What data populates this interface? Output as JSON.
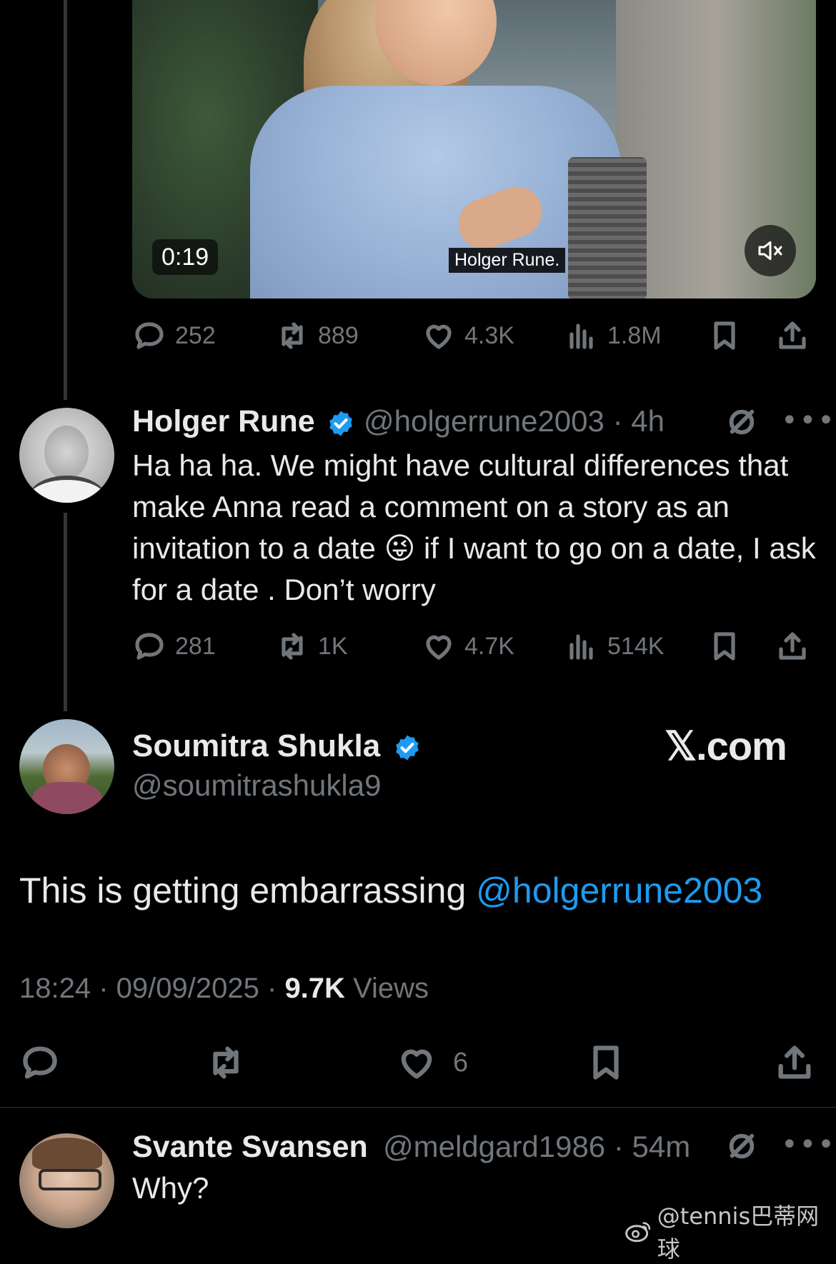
{
  "video": {
    "timecode": "0:19",
    "caption": "Holger Rune.",
    "mute_icon": "speaker-muted-icon"
  },
  "tweet1_actions": {
    "replies": "252",
    "reposts": "889",
    "likes": "4.3K",
    "views": "1.8M"
  },
  "holger_tweet": {
    "name": "Holger Rune",
    "handle": "@holgerrune2003",
    "time": "· 4h",
    "text_before_emoji": "Ha ha ha. We might have cultural differences that make Anna read a comment on a story as an invitation to a date",
    "emoji": "😜",
    "text_after_emoji": " if I want to go on a date, I ask for a date . Don’t worry",
    "replies": "281",
    "reposts": "1K",
    "likes": "4.7K",
    "views": "514K"
  },
  "main_tweet": {
    "name": "Soumitra Shukla",
    "handle": "@soumitrashukla9",
    "brand": "𝕏.com",
    "text": "This is getting embarrassing ",
    "mention": "@holgerrune2003",
    "time": "18:24",
    "date": "09/09/2025",
    "views_count": "9.7K",
    "views_label": "Views",
    "likes": "6"
  },
  "reply_tweet": {
    "name": "Svante Svansen",
    "handle": "@meldgard1986",
    "time": "· 54m",
    "text": "Why?"
  },
  "watermark": "@tennis巴蒂网球",
  "colors": {
    "background": "#000000",
    "text": "#e7e9ea",
    "muted": "#71767b",
    "accent": "#1d9bf0"
  }
}
